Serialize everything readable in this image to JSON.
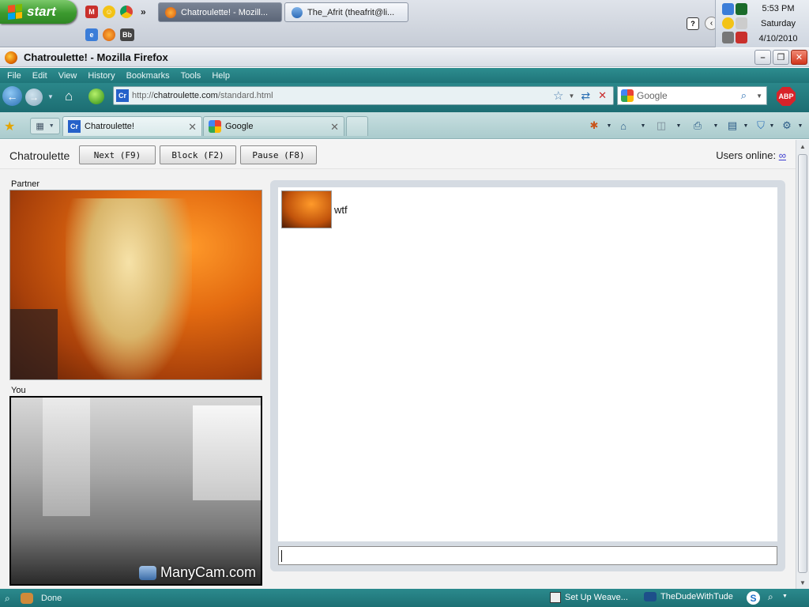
{
  "taskbar": {
    "start_label": "start",
    "tasks": [
      {
        "label": "Chatroulette! - Mozill..."
      },
      {
        "label": "The_Afrit (theafrit@li..."
      }
    ],
    "overflow": "»",
    "clock": {
      "time": "5:53 PM",
      "day": "Saturday",
      "date": "4/10/2010"
    },
    "help_glyph": "?"
  },
  "window": {
    "title": "Chatroulette! - Mozilla Firefox",
    "controls": {
      "minimize": "–",
      "maximize": "❐",
      "close": "✕"
    }
  },
  "menubar": [
    "File",
    "Edit",
    "View",
    "History",
    "Bookmarks",
    "Tools",
    "Help"
  ],
  "navbar": {
    "url_prefix": "http://",
    "url_host": "chatroulette.com",
    "url_path": "/standard.html",
    "url_favicon": "Cr",
    "search_placeholder": "Google",
    "abp": "ABP"
  },
  "tabs": [
    {
      "label": "Chatroulette!",
      "favicon": "Cr"
    },
    {
      "label": "Google"
    }
  ],
  "page": {
    "brand": "Chatroulette",
    "buttons": {
      "next": "Next (F9)",
      "block": "Block (F2)",
      "pause": "Pause (F8)"
    },
    "users_label": "Users online:",
    "users_value": "∞",
    "partner_label": "Partner",
    "you_label": "You",
    "manycam": "ManyCam.com",
    "chat": {
      "message": "wtf"
    }
  },
  "status": {
    "text": "Done",
    "item1": "Set Up Weave...",
    "item2": "TheDudeWithTude"
  }
}
